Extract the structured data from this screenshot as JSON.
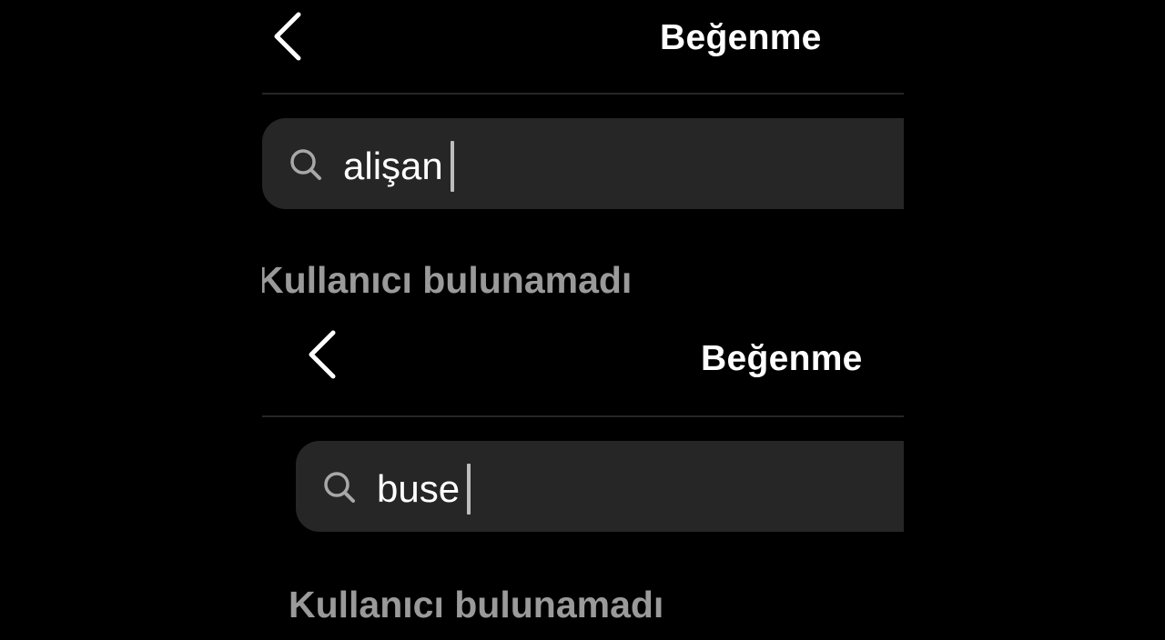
{
  "colors": {
    "background": "#000000",
    "search_field": "#262626",
    "divider": "#262626",
    "title_text": "#ffffff",
    "muted_text": "#9a9a9a",
    "caret": "#bdbdbd"
  },
  "icons": {
    "back": "chevron-left-icon",
    "search": "search-icon"
  },
  "screens": [
    {
      "header_title": "Beğenme",
      "search_value": "alişan",
      "result_message": "Kullanıcı bulunamadı"
    },
    {
      "header_title": "Beğenme",
      "search_value": "buse",
      "result_message": "Kullanıcı bulunamadı"
    }
  ]
}
